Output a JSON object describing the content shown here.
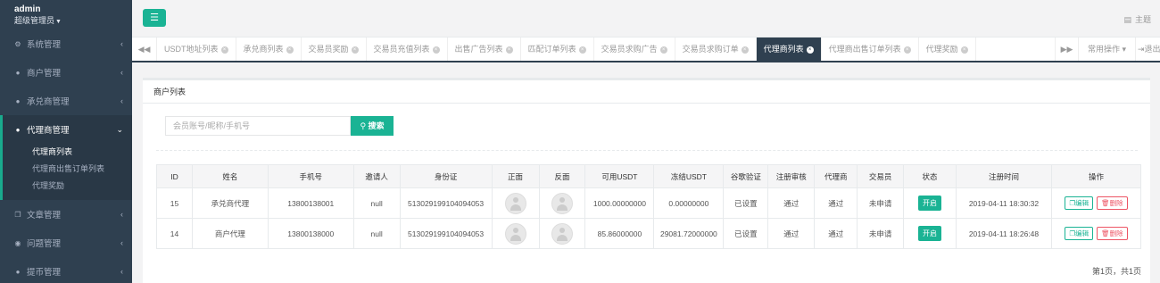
{
  "user": {
    "name": "admin",
    "role": "超级管理员"
  },
  "sidebar": {
    "items": [
      {
        "label": "系统管理",
        "icon": "gear-icon"
      },
      {
        "label": "商户管理",
        "icon": "user-icon"
      },
      {
        "label": "承兑商管理",
        "icon": "user-icon"
      },
      {
        "label": "代理商管理",
        "icon": "user-icon"
      },
      {
        "label": "文章管理",
        "icon": "copy-icon"
      },
      {
        "label": "问题管理",
        "icon": "comment-icon"
      },
      {
        "label": "提币管理",
        "icon": "user-icon"
      }
    ],
    "subitems": [
      "代理商列表",
      "代理商出售订单列表",
      "代理奖励"
    ]
  },
  "topbar": {
    "theme_label": "主题"
  },
  "tabs": {
    "items": [
      "USDT地址列表",
      "承兑商列表",
      "交易员奖励",
      "交易员充值列表",
      "出售广告列表",
      "匹配订单列表",
      "交易员求购广告",
      "交易员求购订单",
      "代理商列表",
      "代理商出售订单列表",
      "代理奖励"
    ],
    "active_index": 8,
    "ops_label": "常用操作",
    "exit_label": "退出"
  },
  "panel": {
    "title": "商户列表"
  },
  "search": {
    "placeholder": "会员账号/昵称/手机号",
    "button_label": "搜索"
  },
  "table": {
    "headers": [
      "ID",
      "姓名",
      "手机号",
      "邀请人",
      "身份证",
      "正面",
      "反面",
      "可用USDT",
      "冻结USDT",
      "谷歌验证",
      "注册审核",
      "代理商",
      "交易员",
      "状态",
      "注册时间",
      "操作"
    ],
    "rows": [
      {
        "id": "15",
        "name": "承兑商代理",
        "phone": "13800138001",
        "inviter": "null",
        "idcard": "513029199104094053",
        "available": "1000.00000000",
        "frozen": "0.00000000",
        "google": "已设置",
        "review": "通过",
        "agent": "通过",
        "trader": "未申请",
        "status": "开启",
        "time": "2019-04-11 18:30:32",
        "edit": "编辑",
        "del": "删除"
      },
      {
        "id": "14",
        "name": "商户代理",
        "phone": "13800138000",
        "inviter": "null",
        "idcard": "513029199104094053",
        "available": "85.86000000",
        "frozen": "29081.72000000",
        "google": "已设置",
        "review": "通过",
        "agent": "通过",
        "trader": "未申请",
        "status": "开启",
        "time": "2019-04-11 18:26:48",
        "edit": "编辑",
        "del": "删除"
      }
    ]
  },
  "pager": {
    "text": "第1页，共1页"
  },
  "colors": {
    "accent": "#1ab394",
    "sidebar": "#2f4050",
    "danger": "#ed5565"
  }
}
